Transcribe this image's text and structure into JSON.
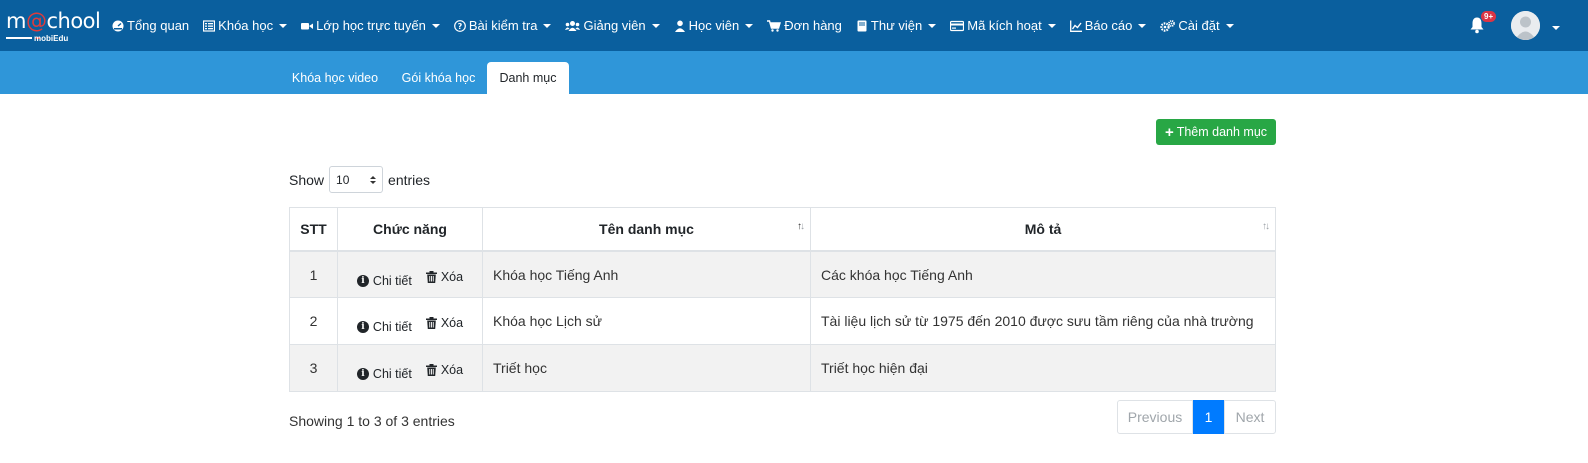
{
  "logo": {
    "main_prefix": "m",
    "main_accent": "@",
    "main_suffix": "chool",
    "sub": "mobiEdu"
  },
  "nav": [
    {
      "label": "Tổng quan",
      "icon": "dashboard-icon",
      "caret": false
    },
    {
      "label": "Khóa học",
      "icon": "list-icon",
      "caret": true
    },
    {
      "label": "Lớp học trực tuyến",
      "icon": "video-icon",
      "caret": true
    },
    {
      "label": "Bài kiểm tra",
      "icon": "question-icon",
      "caret": true
    },
    {
      "label": "Giảng viên",
      "icon": "users-icon",
      "caret": true
    },
    {
      "label": "Học viên",
      "icon": "user-icon",
      "caret": true
    },
    {
      "label": "Đơn hàng",
      "icon": "cart-icon",
      "caret": false
    },
    {
      "label": "Thư viện",
      "icon": "book-icon",
      "caret": true
    },
    {
      "label": "Mã kích hoạt",
      "icon": "card-icon",
      "caret": true
    },
    {
      "label": "Báo cáo",
      "icon": "chart-icon",
      "caret": true
    },
    {
      "label": "Cài đặt",
      "icon": "gears-icon",
      "caret": true
    }
  ],
  "notifications": {
    "badge": "9+"
  },
  "tabs": [
    {
      "label": "Khóa học video",
      "active": false
    },
    {
      "label": "Gói khóa học",
      "active": false
    },
    {
      "label": "Danh mục",
      "active": true
    }
  ],
  "add_button": {
    "label": "Thêm danh mục"
  },
  "length": {
    "prefix": "Show",
    "value": "10",
    "suffix": "entries"
  },
  "table": {
    "headers": {
      "stt": "STT",
      "fn": "Chức năng",
      "name": "Tên danh mục",
      "desc": "Mô tả"
    },
    "actions": {
      "detail": "Chi tiết",
      "delete": "Xóa"
    },
    "rows": [
      {
        "stt": "1",
        "name": "Khóa học Tiếng Anh",
        "desc": "Các khóa học Tiếng Anh"
      },
      {
        "stt": "2",
        "name": "Khóa học Lịch sử",
        "desc": "Tài liệu lịch sử từ 1975 đến 2010 được sưu tầm riêng của nhà trường"
      },
      {
        "stt": "3",
        "name": "Triết học",
        "desc": "Triết học hiện đại"
      }
    ]
  },
  "info": "Showing 1 to 3 of 3 entries",
  "pagination": {
    "previous": "Previous",
    "current": "1",
    "next": "Next"
  },
  "colors": {
    "navbar": "#0a5f9e",
    "subbar": "#2f96d9",
    "add_button": "#28a745",
    "page_active": "#007bff",
    "badge": "#dc3545"
  }
}
